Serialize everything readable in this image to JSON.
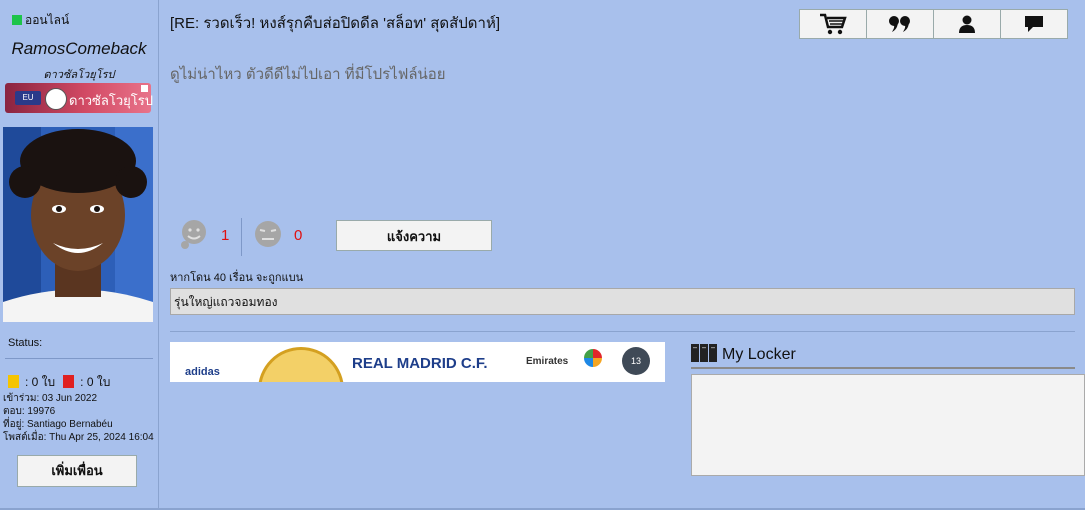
{
  "profile": {
    "online_text": "ออนไลน์",
    "username": "RamosComeback",
    "subtitle": "ดาวซัลโวยุโรป",
    "badge_label": "ดาวซัลโวยุโรป",
    "badge_tag": "EU",
    "status_label": "Status:",
    "yellow_cards": ": 0 ใบ",
    "red_cards": ": 0 ใบ",
    "joined": "เข้าร่วม: 03 Jun 2022",
    "posts": "ตอบ: 19976",
    "location": "ที่อยู่: Santiago Bernabéu",
    "last_post": "โพสต์เมื่อ: Thu Apr 25, 2024 16:04",
    "add_friend_label": "เพิ่มเพื่อน"
  },
  "post": {
    "title": "[RE: รวดเร็ว! หงส์รุกคืบส่อปิดดีล 'สล็อท' สุดสัปดาห์]",
    "message": "ดูไม่น่าไหว ตัวดีดีไม่ไปเอา ที่มีโปรไฟล์น่อย",
    "likes": "1",
    "dislikes": "0",
    "report_label": "แจ้งความ",
    "ban_note": "หากโดน 40 เรื่อน จะถูกแบน",
    "signature": "รุ่นใหญ่แถวจอมทอง"
  },
  "actions": [
    {
      "icon": "cart-icon"
    },
    {
      "icon": "quote-icon"
    },
    {
      "icon": "user-icon"
    },
    {
      "icon": "message-icon"
    }
  ],
  "banner": {
    "sponsor": "adidas",
    "club": "REAL MADRID C.F.",
    "airline": "Emirates",
    "ucl_count": "13"
  },
  "locker": {
    "title": "My Locker"
  },
  "colors": {
    "background": "#a8c0ec",
    "online": "#1dc44a",
    "count": "#e01010"
  }
}
